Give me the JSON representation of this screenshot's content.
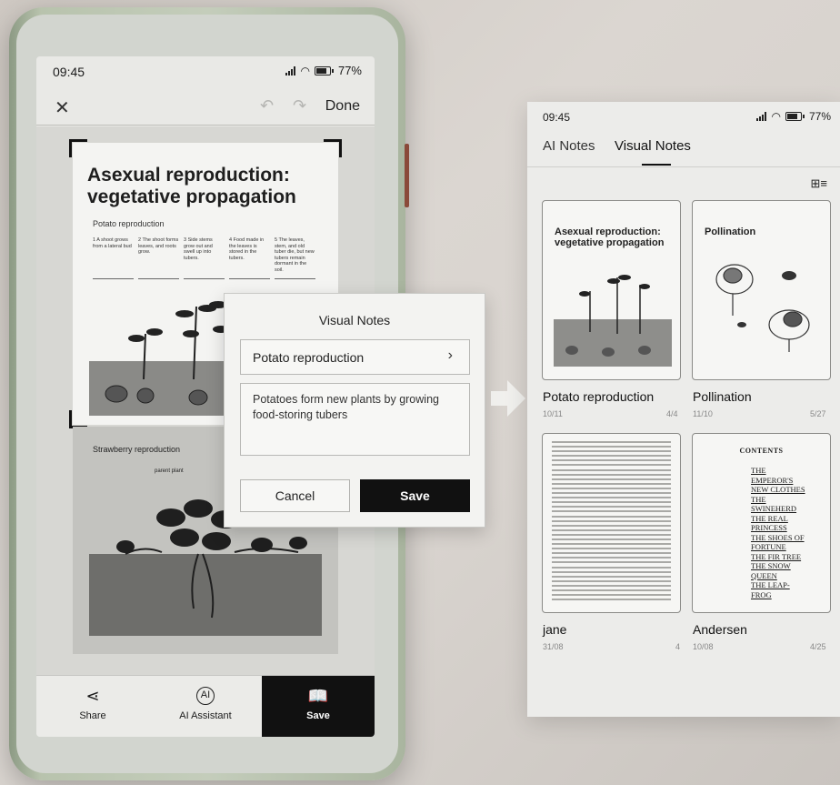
{
  "device": {
    "status": {
      "time": "09:45",
      "battery": "77%"
    },
    "toolbar": {
      "done_label": "Done"
    },
    "document": {
      "title_line1": "Asexual reproduction:",
      "title_line2": "vegetative propagation",
      "subtitle": "Potato reproduction",
      "steps": [
        "1 A shoot grows from a lateral bud",
        "2 The shoot forms leaves, and roots grow.",
        "3 Side stems grow out and swell up into tubers.",
        "4 Food made in the leaves is stored in the tubers.",
        "5 The leaves, stem, and old tuber die, but new tubers remain dormant in the soil."
      ],
      "page2_label": "Strawberry reproduction",
      "parent_plant_label": "parent plant"
    },
    "bottom_bar": {
      "share": "Share",
      "assistant": "AI Assistant",
      "save": "Save"
    }
  },
  "dialog": {
    "title": "Visual Notes",
    "category": "Potato reproduction",
    "note_text": "Potatoes form new plants by growing food-storing tubers",
    "cancel_label": "Cancel",
    "save_label": "Save"
  },
  "panel": {
    "status": {
      "time": "09:45",
      "battery": "77%"
    },
    "tabs": [
      "AI Notes",
      "Visual Notes"
    ],
    "active_tab": "Visual Notes",
    "cards": [
      {
        "name": "Potato reproduction",
        "date": "10/11",
        "count": "4/4",
        "thumb_title": "Asexual reproduction: vegetative propagation"
      },
      {
        "name": "Pollination",
        "date": "11/10",
        "count": "5/27",
        "thumb_title": "Pollination"
      },
      {
        "name": "jane",
        "date": "31/08",
        "count": "4"
      },
      {
        "name": "Andersen",
        "date": "10/08",
        "count": "4/25",
        "toc_heading": "CONTENTS",
        "toc_items": [
          "THE",
          "EMPEROR'S",
          "NEW CLOTHES",
          "THE",
          "SWINEHERD",
          "THE REAL",
          "PRINCESS",
          "THE SHOES OF",
          "FORTUNE",
          "THE FIR TREE",
          "THE SNOW",
          "QUEEN",
          "THE LEAP-",
          "FROG"
        ]
      }
    ]
  }
}
